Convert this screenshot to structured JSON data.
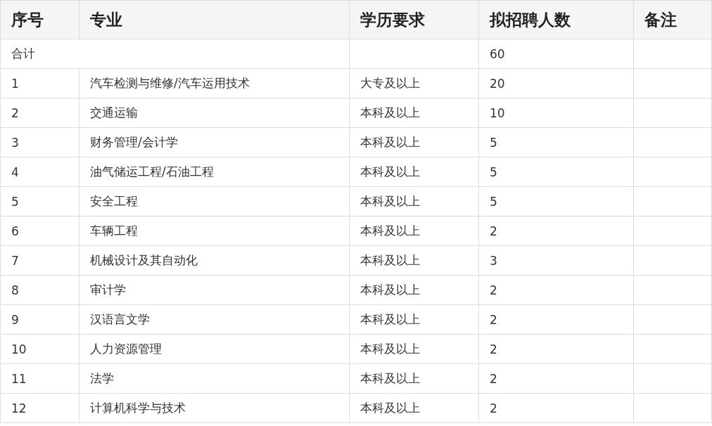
{
  "table": {
    "columns": [
      "序号",
      "专业",
      "学历要求",
      "拟招聘人数",
      "备注"
    ],
    "total": {
      "label": "合计",
      "count": "60"
    },
    "rows": [
      {
        "no": "1",
        "major": "汽车检测与维修/汽车运用技术",
        "education": "大专及以上",
        "count": "20"
      },
      {
        "no": "2",
        "major": "交通运输",
        "education": "本科及以上",
        "count": "10"
      },
      {
        "no": "3",
        "major": "财务管理/会计学",
        "education": "本科及以上",
        "count": "5"
      },
      {
        "no": "4",
        "major": "油气储运工程/石油工程",
        "education": "本科及以上",
        "count": "5"
      },
      {
        "no": "5",
        "major": "安全工程",
        "education": "本科及以上",
        "count": "5"
      },
      {
        "no": "6",
        "major": "车辆工程",
        "education": "本科及以上",
        "count": "2"
      },
      {
        "no": "7",
        "major": "机械设计及其自动化",
        "education": "本科及以上",
        "count": "3"
      },
      {
        "no": "8",
        "major": "审计学",
        "education": "本科及以上",
        "count": "2"
      },
      {
        "no": "9",
        "major": "汉语言文学",
        "education": "本科及以上",
        "count": "2"
      },
      {
        "no": "10",
        "major": "人力资源管理",
        "education": "本科及以上",
        "count": "2"
      },
      {
        "no": "11",
        "major": "法学",
        "education": "本科及以上",
        "count": "2"
      },
      {
        "no": "12",
        "major": "计算机科学与技术",
        "education": "本科及以上",
        "count": "2"
      }
    ]
  }
}
